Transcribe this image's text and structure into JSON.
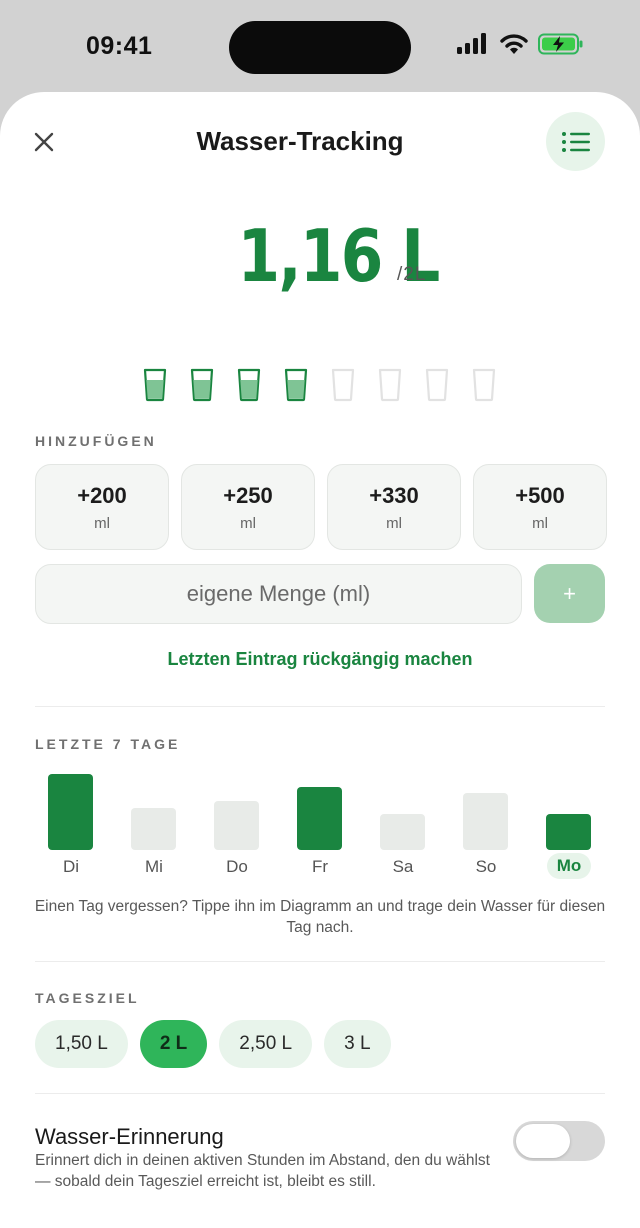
{
  "status_bar": {
    "time": "09:41"
  },
  "header": {
    "title": "Wasser-Tracking"
  },
  "intake": {
    "amount": "1,16 L",
    "goal": "/2L",
    "glasses_filled": 4,
    "glasses_total": 8
  },
  "add_section": {
    "label": "HINZUFÜGEN",
    "buttons": [
      {
        "value": "+200",
        "unit": "ml"
      },
      {
        "value": "+250",
        "unit": "ml"
      },
      {
        "value": "+330",
        "unit": "ml"
      },
      {
        "value": "+500",
        "unit": "ml"
      }
    ],
    "custom_placeholder": "eigene Menge (ml)",
    "custom_add_label": "+",
    "undo_label": "Letzten Eintrag rückgängig machen"
  },
  "history": {
    "label": "LETZTE 7 TAGE",
    "days": [
      "Di",
      "Mi",
      "Do",
      "Fr",
      "Sa",
      "So",
      "Mo"
    ],
    "hint": "Einen Tag vergessen? Tippe ihn im Diagramm an und trage dein Wasser für diesen Tag nach."
  },
  "chart_data": {
    "type": "bar",
    "categories": [
      "Di",
      "Mi",
      "Do",
      "Fr",
      "Sa",
      "So",
      "Mo"
    ],
    "values": [
      2.0,
      1.1,
      1.3,
      1.65,
      0.95,
      1.5,
      0.95
    ],
    "goal_met": [
      true,
      false,
      false,
      true,
      false,
      false,
      true
    ],
    "today": "Mo"
  },
  "daily_goal": {
    "label": "TAGESZIEL",
    "options": [
      "1,50 L",
      "2 L",
      "2,50 L",
      "3 L"
    ],
    "selected": "2 L"
  },
  "reminder": {
    "title": "Wasser-Erinnerung",
    "description": "Erinnert dich in deinen aktiven Stunden im Abstand, den du wählst — sobald dein Tagesziel erreicht ist, bleibt es still.",
    "enabled": false
  },
  "colors": {
    "accent": "#1a8540",
    "accent_light": "#e7f4ea",
    "bar_inactive": "#e8ebe8",
    "goal_active": "#2fb55a"
  }
}
